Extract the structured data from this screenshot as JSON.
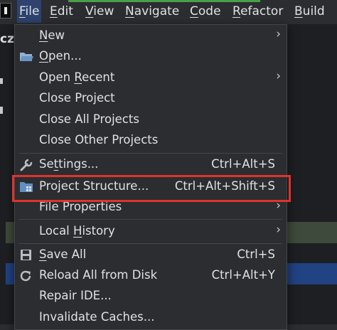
{
  "menubar": {
    "items": [
      {
        "label": "File",
        "underline": "F",
        "rest": "ile"
      },
      {
        "label": "Edit",
        "underline": "E",
        "rest": "dit"
      },
      {
        "label": "View",
        "underline": "V",
        "rest": "iew"
      },
      {
        "label": "Navigate",
        "underline": "N",
        "rest": "avigate"
      },
      {
        "label": "Code",
        "underline": "C",
        "rest": "ode"
      },
      {
        "label": "Refactor",
        "underline": "R",
        "rest": "efactor"
      },
      {
        "label": "Build",
        "underline": "B",
        "rest": "uild"
      }
    ]
  },
  "left_panel": {
    "tab_label": "cz"
  },
  "file_menu": {
    "new": {
      "u": "N",
      "rest": "ew"
    },
    "open": {
      "u": "O",
      "rest": "pen..."
    },
    "open_recent": {
      "pre": "Open ",
      "u": "R",
      "rest": "ecent"
    },
    "close_project": "Close Project",
    "close_all": "Close All Projects",
    "close_other": "Close Other Projects",
    "settings": {
      "pre": "Se",
      "u": "t",
      "rest": "tings..."
    },
    "settings_shortcut": "Ctrl+Alt+S",
    "project_structure": "Project Structure...",
    "project_structure_shortcut": "Ctrl+Alt+Shift+S",
    "file_properties": "File Properties",
    "local_history": {
      "pre": "Local ",
      "u": "H",
      "rest": "istory"
    },
    "save_all": {
      "u": "S",
      "rest": "ave All"
    },
    "save_all_shortcut": "Ctrl+S",
    "reload": "Reload All from Disk",
    "reload_shortcut": "Ctrl+Alt+Y",
    "repair": "Repair IDE...",
    "invalidate": "Invalidate Caches..."
  },
  "colors": {
    "accent": "#2e436e",
    "highlight_border": "#e0322e",
    "menu_bg": "#2b2d30"
  }
}
